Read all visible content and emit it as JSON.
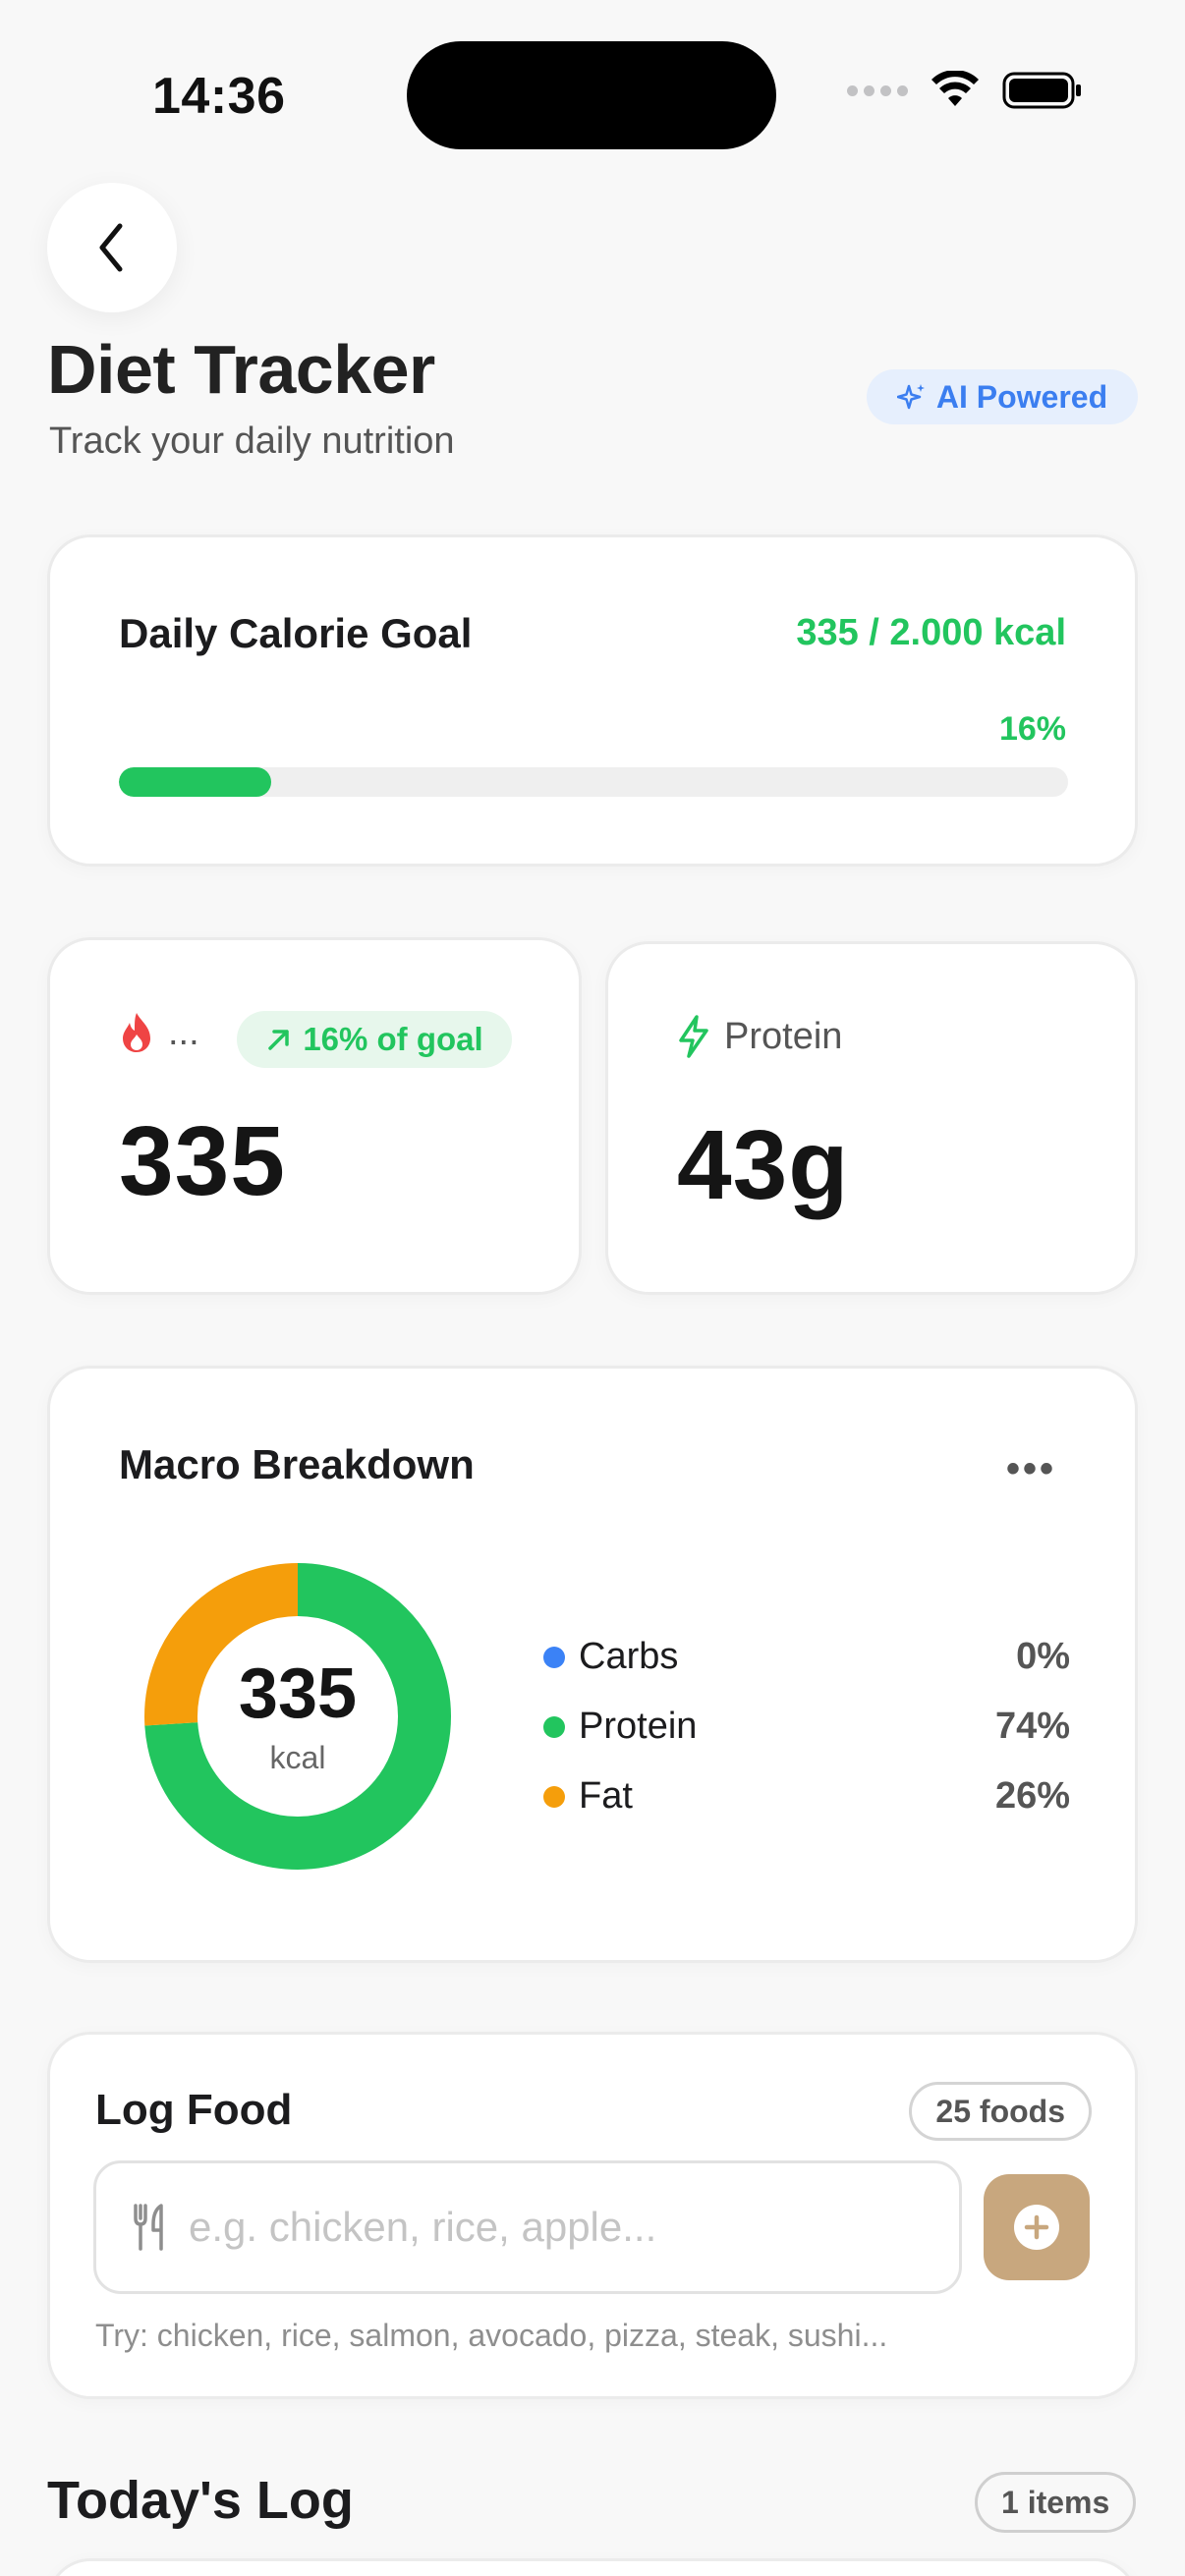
{
  "status_bar": {
    "time": "14:36"
  },
  "header": {
    "title": "Diet Tracker",
    "subtitle": "Track your daily nutrition",
    "badge": "AI Powered"
  },
  "goal": {
    "label": "Daily Calorie Goal",
    "value_text": "335 / 2.000 kcal",
    "percent_text": "16%",
    "progress_fraction": 0.16
  },
  "stats": {
    "calories": {
      "label": "...",
      "chip": "16% of goal",
      "value": "335"
    },
    "protein": {
      "label": "Protein",
      "value": "43g"
    }
  },
  "macro": {
    "title": "Macro Breakdown",
    "more": "•••",
    "center_value": "335",
    "center_unit": "kcal",
    "items": [
      {
        "name": "Carbs",
        "value": "0%",
        "fraction": 0.0,
        "color": "#3b82f6"
      },
      {
        "name": "Protein",
        "value": "74%",
        "fraction": 0.74,
        "color": "#22c55e"
      },
      {
        "name": "Fat",
        "value": "26%",
        "fraction": 0.26,
        "color": "#f59e0b"
      }
    ]
  },
  "log_food": {
    "title": "Log Food",
    "count_chip": "25 foods",
    "placeholder": "e.g. chicken, rice, apple...",
    "hint": "Try: chicken, rice, salmon, avocado, pizza, steak, sushi..."
  },
  "today": {
    "title": "Today's Log",
    "count_chip": "1 items"
  },
  "colors": {
    "accent_green": "#22c55e",
    "ai_blue": "#3b7ef0",
    "add_button": "#c8a77e",
    "flame": "#ef4444"
  }
}
